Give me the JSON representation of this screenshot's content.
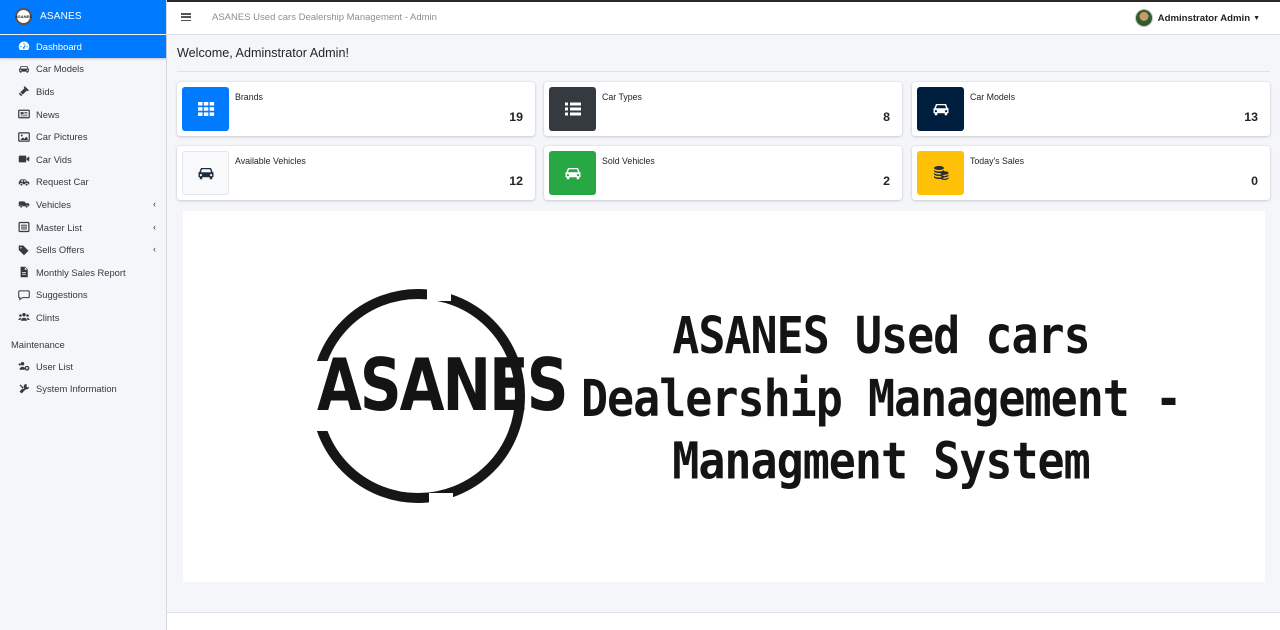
{
  "brand": {
    "name": "ASANES",
    "logo_text": "ASANES"
  },
  "topbar": {
    "title": "ASANES Used cars Dealership Management - Admin",
    "user_name": "Adminstrator Admin"
  },
  "sidebar": {
    "items": [
      {
        "label": "Dashboard",
        "icon": "dashboard-icon"
      },
      {
        "label": "Car Models",
        "icon": "car-icon"
      },
      {
        "label": "Bids",
        "icon": "gavel-icon"
      },
      {
        "label": "News",
        "icon": "newspaper-icon"
      },
      {
        "label": "Car Pictures",
        "icon": "image-icon"
      },
      {
        "label": "Car Vids",
        "icon": "video-icon"
      },
      {
        "label": "Request Car",
        "icon": "car-side-icon"
      },
      {
        "label": "Vehicles",
        "icon": "truck-icon"
      },
      {
        "label": "Master List",
        "icon": "list-icon"
      },
      {
        "label": "Sells Offers",
        "icon": "tags-icon"
      },
      {
        "label": "Monthly Sales Report",
        "icon": "file-icon"
      },
      {
        "label": "Suggestions",
        "icon": "comment-icon"
      },
      {
        "label": "Clints",
        "icon": "users-icon"
      }
    ],
    "maintenance_header": "Maintenance",
    "maintenance_items": [
      {
        "label": "User List",
        "icon": "users-cog-icon"
      },
      {
        "label": "System Information",
        "icon": "tools-icon"
      }
    ]
  },
  "main": {
    "welcome": "Welcome, Adminstrator Admin!",
    "cards": [
      {
        "label": "Brands",
        "value": "19",
        "color": "#007bff",
        "icon": "th-icon"
      },
      {
        "label": "Car Types",
        "value": "8",
        "color": "#343a40",
        "icon": "list-icon"
      },
      {
        "label": "Car Models",
        "value": "13",
        "color": "#001f3f",
        "icon": "car-icon"
      },
      {
        "label": "Available Vehicles",
        "value": "12",
        "color": "#f8f9fa",
        "icon": "car-icon"
      },
      {
        "label": "Sold Vehicles",
        "value": "2",
        "color": "#28a745",
        "icon": "car-icon"
      },
      {
        "label": "Today's Sales",
        "value": "0",
        "color": "#ffc107",
        "icon": "coins-icon"
      }
    ],
    "banner": {
      "logo_text": "ASANES",
      "title_line1": "ASANES Used cars",
      "title_line2": "Dealership Management -",
      "title_line3": "Managment System"
    }
  }
}
